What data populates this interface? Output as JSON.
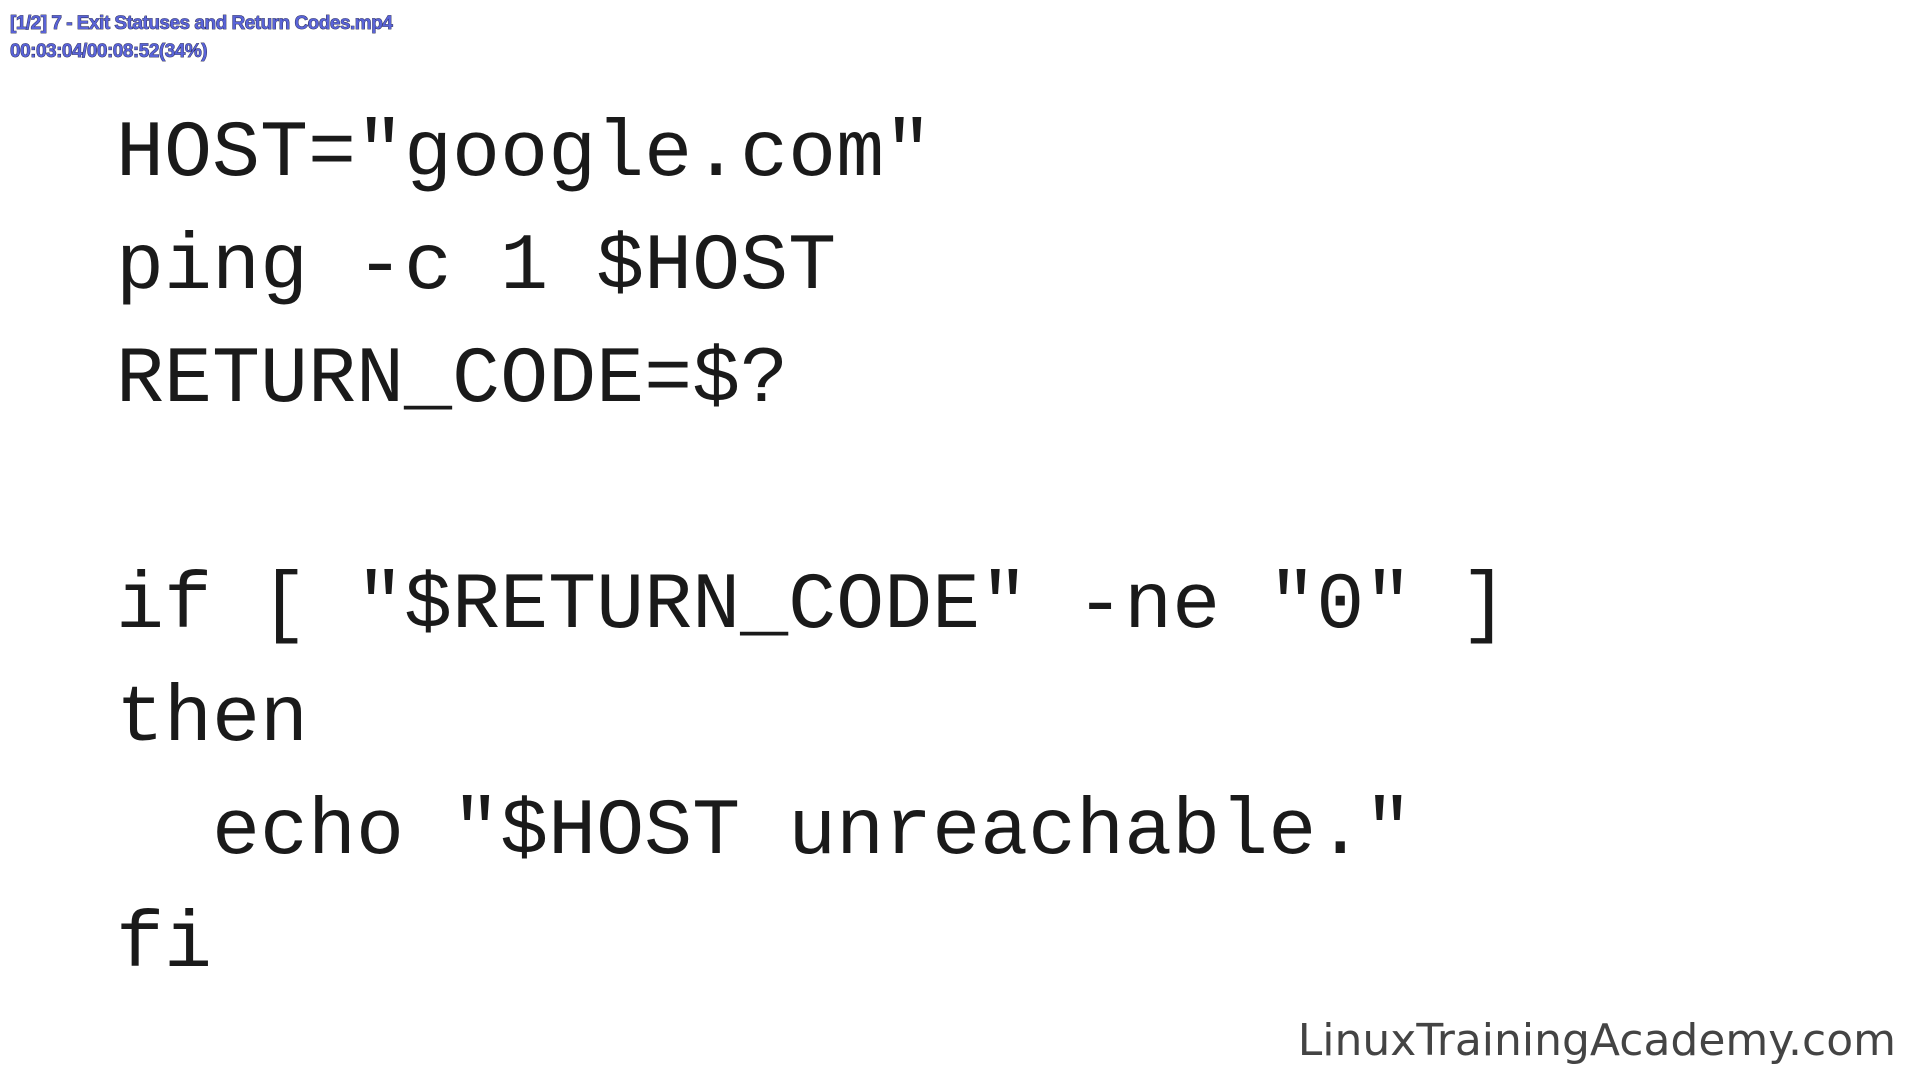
{
  "player_overlay": {
    "file_title": "[1/2] 7 - Exit Statuses and Return Codes.mp4",
    "time_position": "00:03:04/00:08:52(34%)"
  },
  "slide": {
    "code_lines": [
      "HOST=\"google.com\"",
      "ping -c 1 $HOST",
      "RETURN_CODE=$?",
      "",
      "if [ \"$RETURN_CODE\" -ne \"0\" ]",
      "then",
      "  echo \"$HOST unreachable.\"",
      "fi"
    ],
    "watermark": "LinuxTrainingAcademy.com"
  }
}
